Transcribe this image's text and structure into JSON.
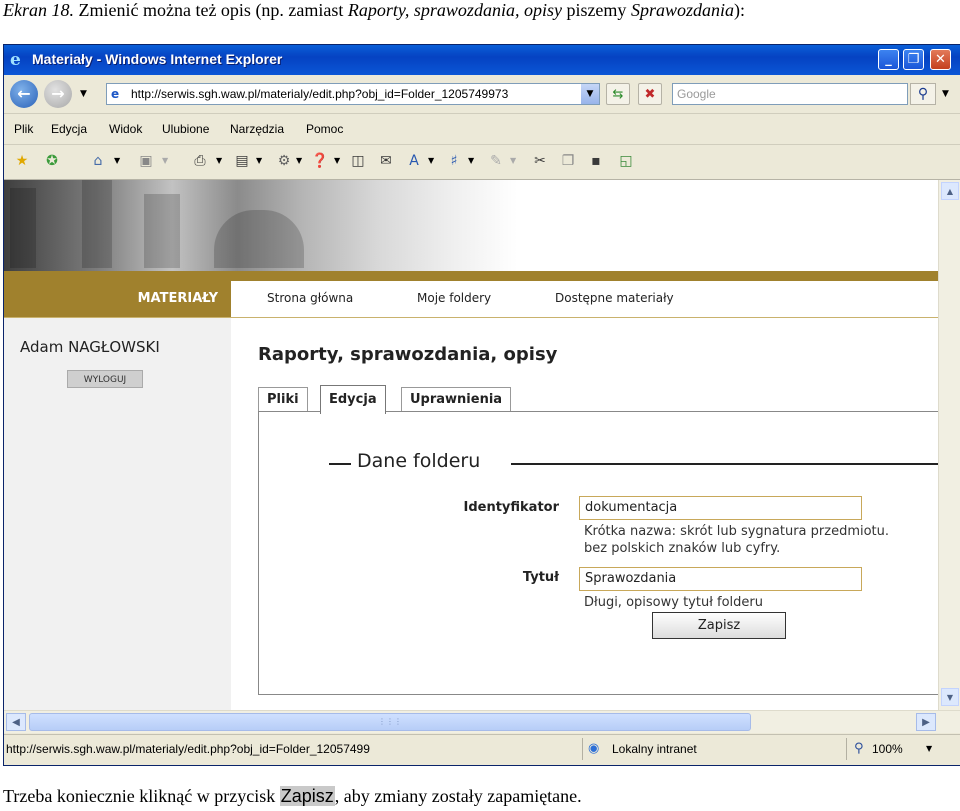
{
  "captions": {
    "top_prefix": "Ekran 18.",
    "top_main": " Zmienić można też opis (np. zamiast ",
    "top_old": "Raporty, sprawozdania, opisy",
    "top_mid": " piszemy ",
    "top_new": "Sprawozdania",
    "top_end": "):",
    "bottom_pre": "Trzeba koniecznie kliknąć w przycisk ",
    "bottom_hl": "Zapisz",
    "bottom_post": ", aby zmiany zostały zapamiętane."
  },
  "window": {
    "title": "Materiały - Windows Internet Explorer",
    "minimize": "_",
    "maximize": "❐",
    "close": "✕"
  },
  "address_bar": {
    "url": "http://serwis.sgh.waw.pl/materialy/edit.php?obj_id=Folder_1205749973",
    "search_placeholder": "Google"
  },
  "menu": [
    "Plik",
    "Edycja",
    "Widok",
    "Ulubione",
    "Narzędzia",
    "Pomoc"
  ],
  "site_nav": {
    "brand": "MATERIAŁY",
    "links": [
      "Strona główna",
      "Moje foldery",
      "Dostępne materiały"
    ]
  },
  "sidebar": {
    "user": "Adam NAGŁOWSKI",
    "logout": "WYLOGUJ"
  },
  "page": {
    "title": "Raporty, sprawozdania, opisy",
    "tabs": [
      "Pliki",
      "Edycja",
      "Uprawnienia"
    ],
    "active_tab": "Edycja"
  },
  "form": {
    "legend": "Dane folderu",
    "id_label": "Identyfikator",
    "id_value": "dokumentacja",
    "id_hint_1": "Krótka nazwa: skrót lub sygnatura przedmiotu.",
    "id_hint_2": "bez polskich znaków lub cyfry.",
    "title_label": "Tytuł",
    "title_value": "Sprawozdania",
    "title_hint": "Długi, opisowy tytuł folderu",
    "save": "Zapisz"
  },
  "status_bar": {
    "url": "http://serwis.sgh.waw.pl/materialy/edit.php?obj_id=Folder_12057499",
    "zone": "Lokalny intranet",
    "zoom": "100%"
  },
  "icons": {
    "back": "back-arrow-icon",
    "forward": "forward-arrow-icon",
    "refresh": "refresh-icon",
    "stop": "stop-icon",
    "search": "search-icon",
    "favorites": "star-icon",
    "add_favorites": "add-favorite-icon",
    "home": "home-icon",
    "feeds": "rss-icon",
    "print": "print-icon",
    "page": "page-icon",
    "tools": "gear-icon",
    "help": "help-icon",
    "research": "research-icon",
    "mail": "mail-icon",
    "font": "font-size-icon",
    "translate": "translate-icon",
    "edit": "pencil-icon",
    "cut": "scissors-icon",
    "copy": "copy-icon",
    "paste": "paste-icon",
    "window": "new-window-icon",
    "zone": "globe-icon",
    "zoom": "zoom-icon"
  },
  "colors": {
    "accent_gold": "#a0812d",
    "titlebar_blue": "#0542c2"
  }
}
